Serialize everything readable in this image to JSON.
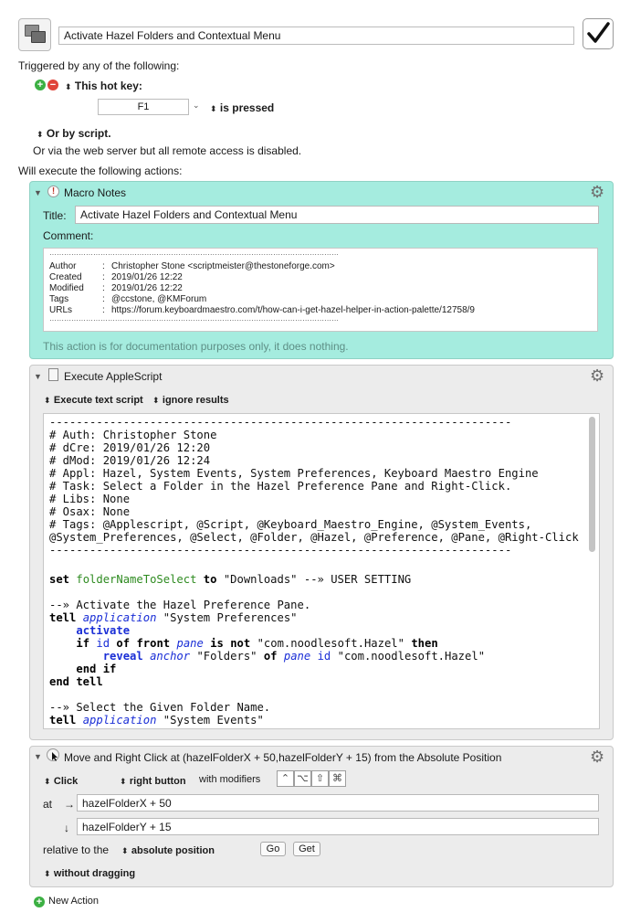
{
  "macro": {
    "name": "Activate Hazel Folders and Contextual Menu",
    "enabled_mark": "✓"
  },
  "triggers": {
    "heading": "Triggered by any of the following:",
    "hotkey_label": "This hot key:",
    "hotkey_value": "F1",
    "hotkey_state": "is pressed",
    "script_label": "Or by script.",
    "webserver_note": "Or via the web server but all remote access is disabled."
  },
  "actions_heading": "Will execute the following actions:",
  "notes_action": {
    "title": "Macro Notes",
    "title_label": "Title:",
    "title_value": "Activate Hazel Folders and Contextual Menu",
    "comment_label": "Comment:",
    "comment_rule": "·········································································································································",
    "comment_rows": [
      {
        "key": "Author",
        "value": "Christopher Stone <scriptmeister@thestoneforge.com>"
      },
      {
        "key": "Created",
        "value": "2019/01/26 12:22"
      },
      {
        "key": "Modified",
        "value": "2019/01/26 12:22"
      },
      {
        "key": "Tags",
        "value": "@ccstone, @KMForum"
      },
      {
        "key": "URLs",
        "value": "https://forum.keyboardmaestro.com/t/how-can-i-get-hazel-helper-in-action-palette/12758/9"
      }
    ],
    "footer": "This action is for documentation purposes only, it does nothing."
  },
  "applescript_action": {
    "title": "Execute AppleScript",
    "mode": "Execute text script",
    "results": "ignore results",
    "script_lines": [
      "---------------------------------------------------------------------",
      "# Auth: Christopher Stone",
      "# dCre: 2019/01/26 12:20",
      "# dMod: 2019/01/26 12:24",
      "# Appl: Hazel, System Events, System Preferences, Keyboard Maestro Engine",
      "# Task: Select a Folder in the Hazel Preference Pane and Right-Click.",
      "# Libs: None",
      "# Osax: None",
      "# Tags: @Applescript, @Script, @Keyboard_Maestro_Engine, @System_Events,",
      "@System_Preferences, @Select, @Folder, @Hazel, @Preference, @Pane, @Right-Click",
      "---------------------------------------------------------------------"
    ],
    "code": {
      "set_kw": "set",
      "var_name": "folderNameToSelect",
      "to_kw": "to",
      "downloads": "\"Downloads\"",
      "user_setting": "--» USER SETTING",
      "comment1": "--» Activate the Hazel Preference Pane.",
      "tell_kw": "tell",
      "application_kw": "application",
      "sys_prefs": "\"System Preferences\"",
      "activate_kw": "activate",
      "if_kw": "if",
      "id_kw": "id",
      "of_kw": "of",
      "front_kw": "front",
      "pane_kw": "pane",
      "is_not_kw": "is not",
      "hazel_id": "\"com.noodlesoft.Hazel\"",
      "then_kw": "then",
      "reveal_kw": "reveal",
      "anchor_kw": "anchor",
      "folders_str": "\"Folders\"",
      "end_if": "end if",
      "end_tell": "end tell",
      "comment2": "--» Select the Given Folder Name.",
      "sys_events": "\"System Events\""
    }
  },
  "click_action": {
    "title": "Move and Right Click at (hazelFolderX + 50,hazelFolderY + 15) from the Absolute Position",
    "click_label": "Click",
    "button_label": "right button",
    "modifiers_label": "with modifiers",
    "modifier_keys": [
      "⌃",
      "⌥",
      "⇧",
      "⌘"
    ],
    "at_label": "at",
    "x_arrow": "→",
    "x_value": "hazelFolderX + 50",
    "y_arrow": "↓",
    "y_value": "hazelFolderY + 15",
    "relative_label": "relative to the",
    "relative_value": "absolute position",
    "go_label": "Go",
    "get_label": "Get",
    "drag_label": "without dragging"
  },
  "new_action_label": "New Action",
  "colors": {
    "notes_bg": "#a5ecdf",
    "notes_border": "#8fd2c4",
    "action_bg": "#ececec",
    "add_green": "#3cb043",
    "remove_red": "#e0443a",
    "keyword_blue": "#1a2ed6",
    "variable_green": "#2e8b20"
  }
}
